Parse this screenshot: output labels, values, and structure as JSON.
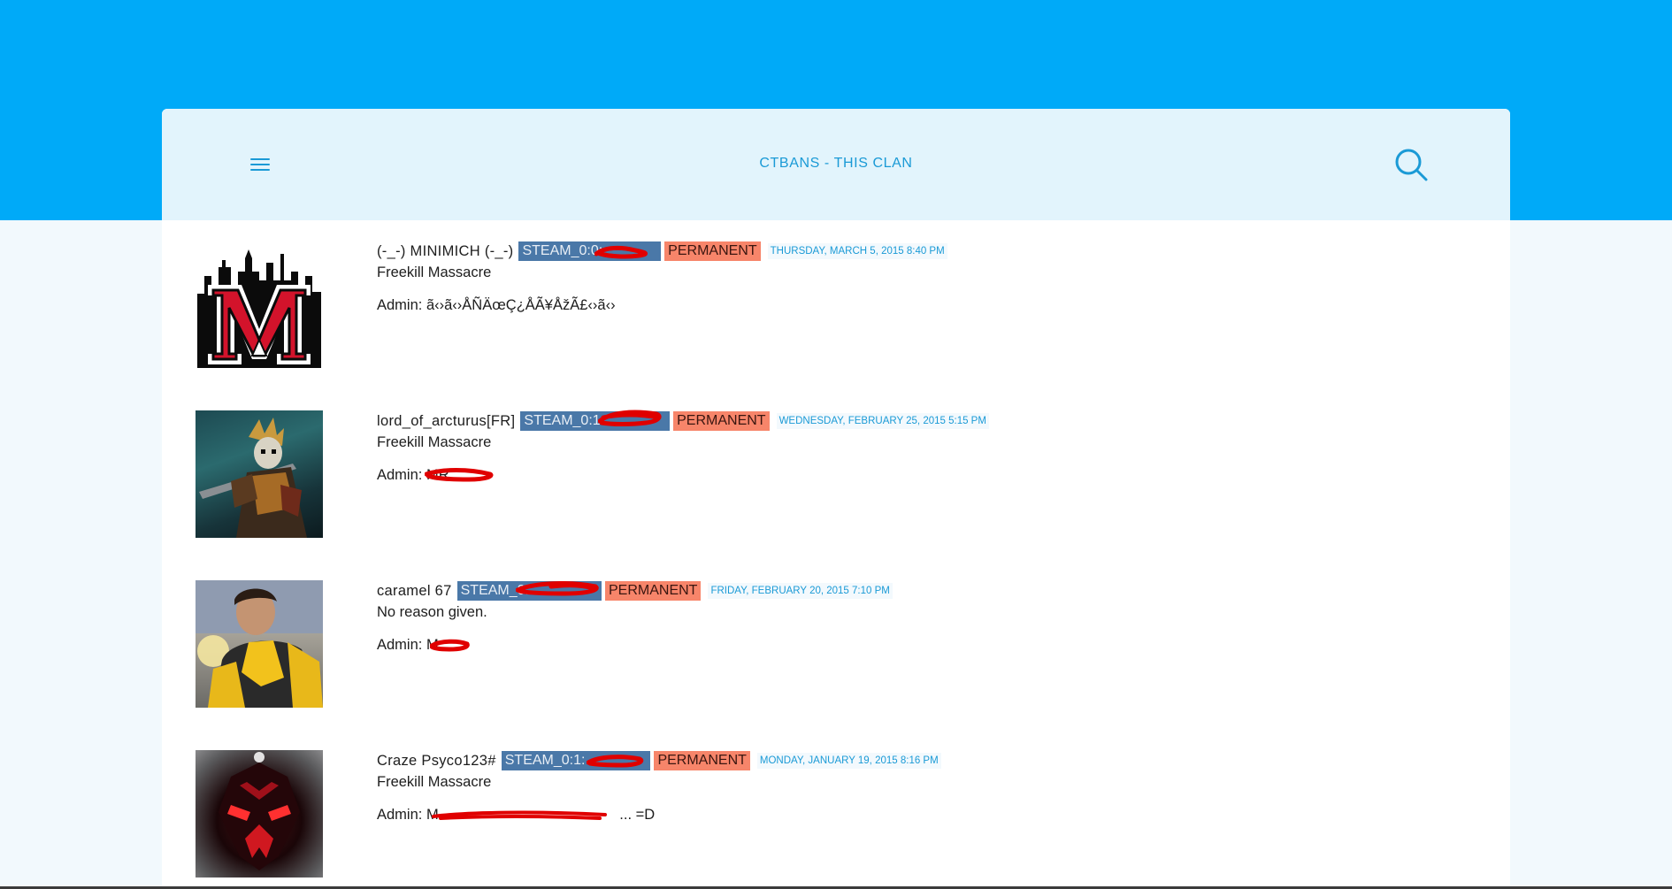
{
  "header": {
    "title": "CTBANS - THIS CLAN",
    "menu_icon": "hamburger-menu-icon",
    "search_icon": "search-icon"
  },
  "colors": {
    "banner": "#00aaf8",
    "header_bg": "#e2f4fc",
    "accent": "#1a9ad6",
    "steam_badge": "#4a78a8",
    "permanent_badge": "#f7856a",
    "redaction": "#e00000"
  },
  "bans": [
    {
      "name": "(-_-) MINIMICH (-_-)",
      "steam_id": "STEAM_0:0:",
      "duration": "PERMANENT",
      "date": "THURSDAY, MARCH 5, 2015 8:40 PM",
      "reason": "Freekill Massacre",
      "admin_label": "Admin:",
      "admin": "ã‹›ã‹›ÅÑÄœÇ¿ÅÃ¥ÅžÃ£‹›ã‹›",
      "avatar": "red-m-skyline-logo"
    },
    {
      "name": "lord_of_arcturus[FR]",
      "steam_id": "STEAM_0:1:",
      "duration": "PERMANENT",
      "date": "WEDNESDAY, FEBRUARY 25, 2015 5:15 PM",
      "reason": "Freekill Massacre",
      "admin_label": "Admin:",
      "admin": "MR.",
      "avatar": "armored-skeleton-knight"
    },
    {
      "name": "caramel 67",
      "steam_id": "STEAM_0:",
      "duration": "PERMANENT",
      "date": "FRIDAY, FEBRUARY 20, 2015 7:10 PM",
      "reason": "No reason given.",
      "admin_label": "Admin:",
      "admin": "M",
      "avatar": "person-yellow-jacket-photo"
    },
    {
      "name": "Craze Psyco123#",
      "steam_id": "STEAM_0:1:",
      "duration": "PERMANENT",
      "date": "MONDAY, JANUARY 19, 2015 8:16 PM",
      "reason": "Freekill Massacre",
      "admin_label": "Admin:",
      "admin": "M",
      "admin_suffix": "... =D",
      "avatar": "red-demon-mask"
    }
  ]
}
